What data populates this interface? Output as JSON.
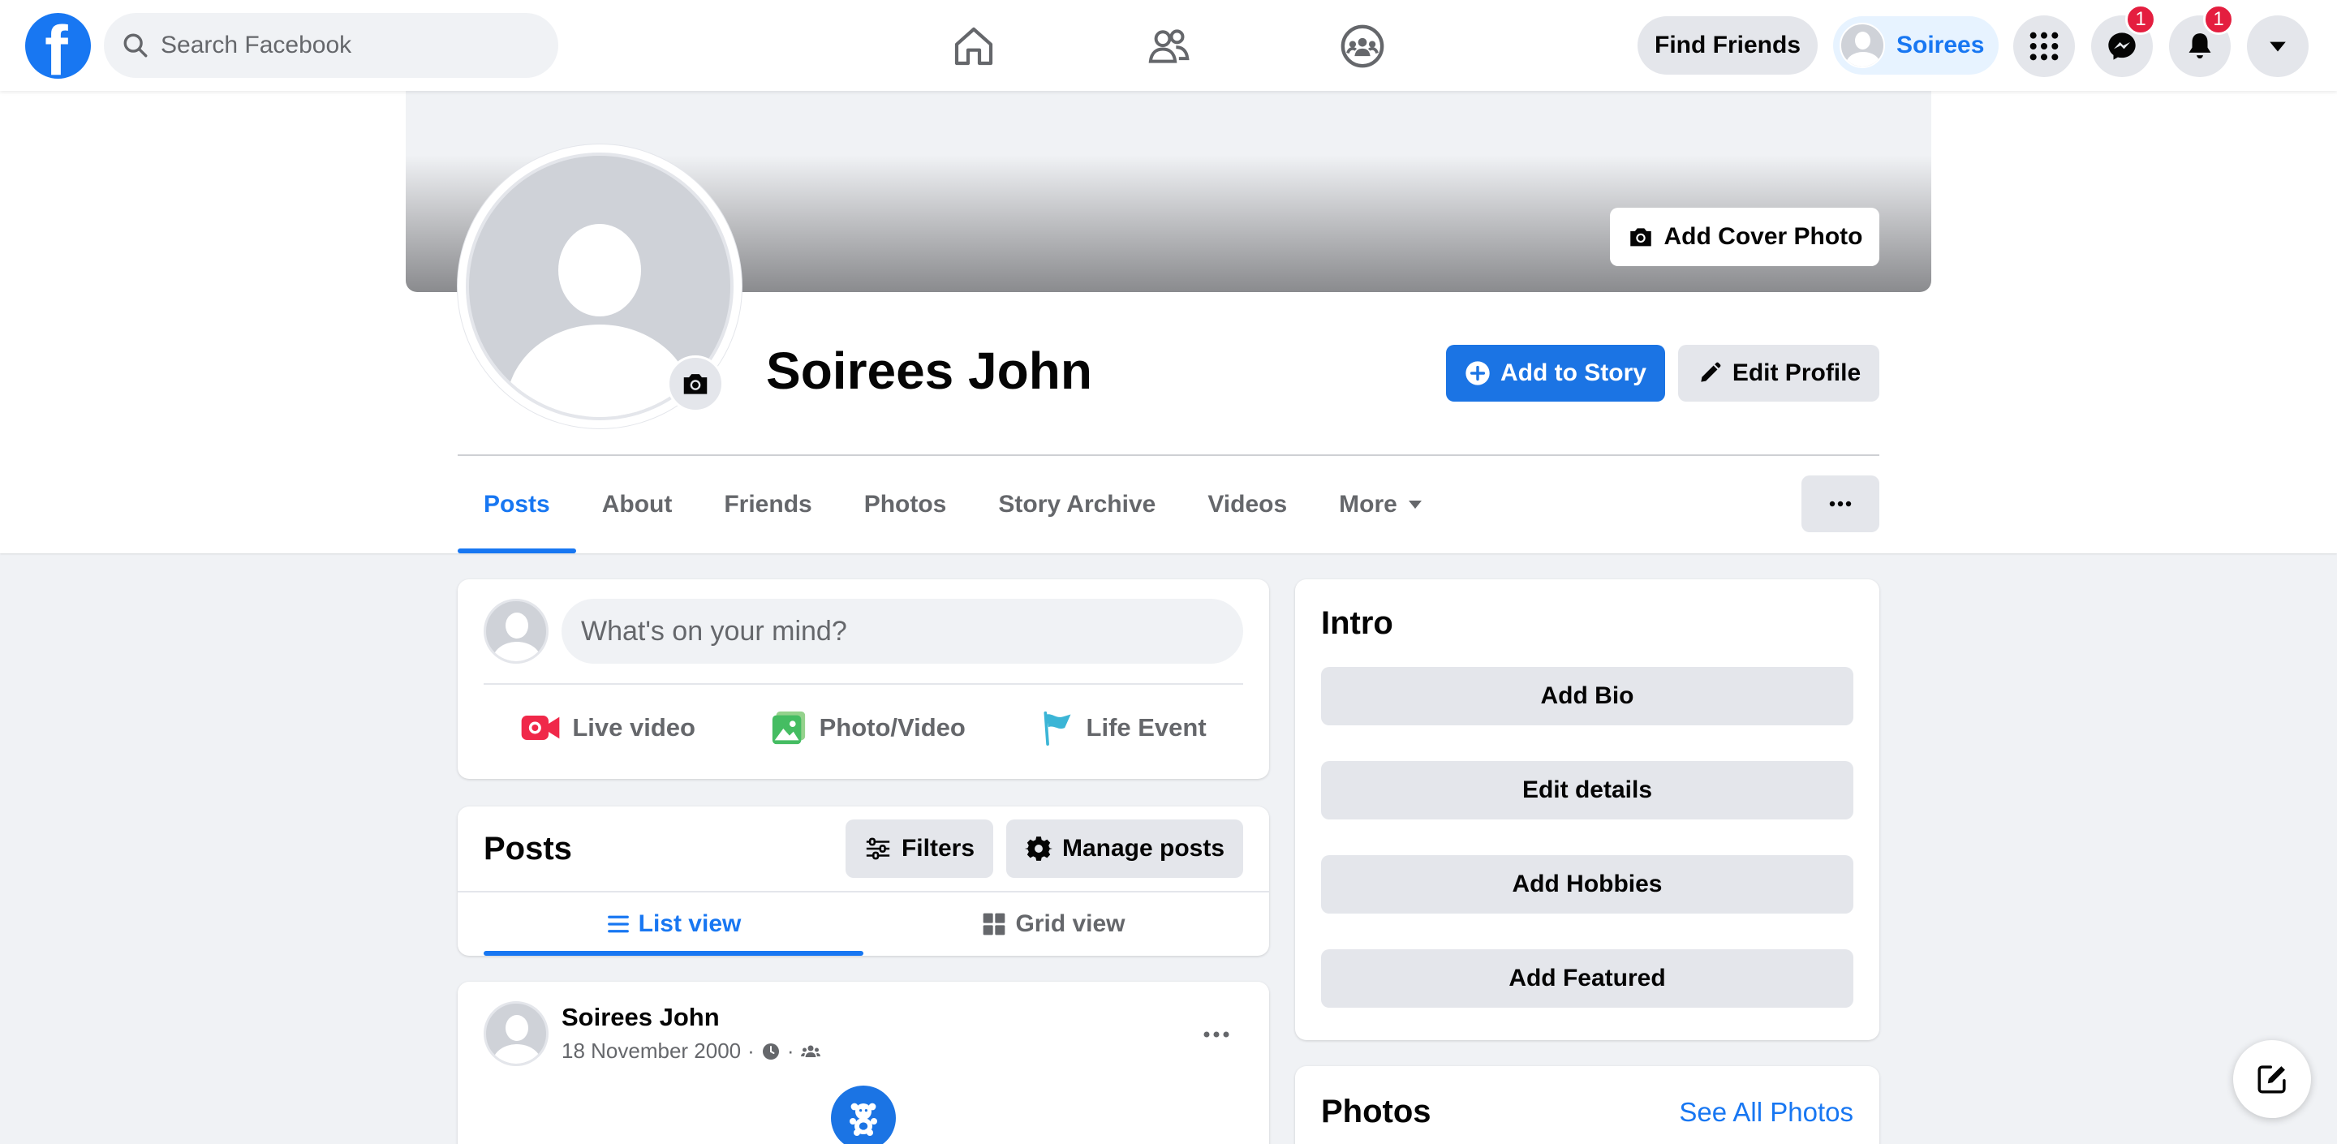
{
  "nav": {
    "search_placeholder": "Search Facebook",
    "find_friends_label": "Find Friends",
    "profile_short_name": "Soirees",
    "messenger_badge": "1",
    "notifications_badge": "1"
  },
  "profile": {
    "name": "Soirees John",
    "add_cover_label": "Add Cover Photo",
    "add_story_label": "Add to Story",
    "edit_profile_label": "Edit Profile"
  },
  "tabs": [
    "Posts",
    "About",
    "Friends",
    "Photos",
    "Story Archive",
    "Videos",
    "More"
  ],
  "composer": {
    "placeholder": "What's on your mind?",
    "actions": [
      "Live video",
      "Photo/Video",
      "Life Event"
    ]
  },
  "posts": {
    "title": "Posts",
    "filters_label": "Filters",
    "manage_label": "Manage posts",
    "list_view_label": "List view",
    "grid_view_label": "Grid view"
  },
  "post": {
    "author": "Soirees John",
    "date": "18 November 2000"
  },
  "intro": {
    "title": "Intro",
    "buttons": [
      "Add Bio",
      "Edit details",
      "Add Hobbies",
      "Add Featured"
    ]
  },
  "photos": {
    "title": "Photos",
    "see_all_label": "See All Photos"
  },
  "colors": {
    "brand": "#1877f2",
    "badge": "#e41e3f",
    "background": "#f0f2f5"
  }
}
